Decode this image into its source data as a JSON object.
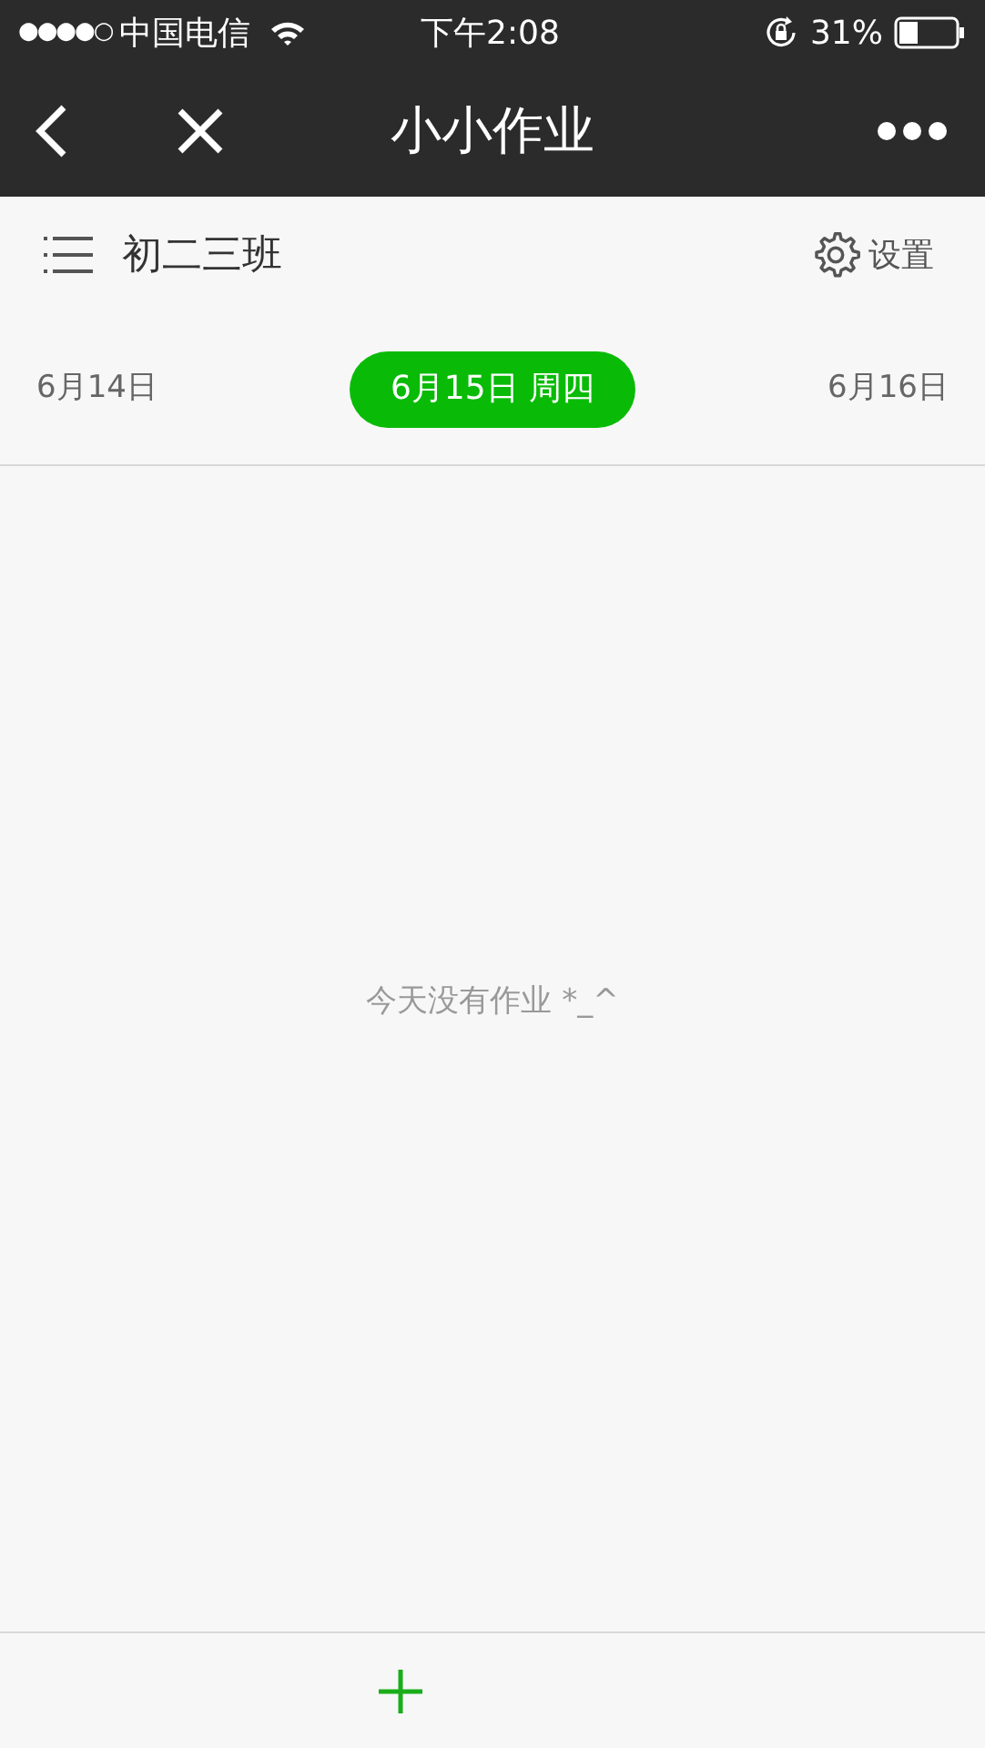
{
  "status_bar": {
    "signal_dots": "●●●●○",
    "carrier": "中国电信",
    "time": "下午2:08",
    "battery": "31%"
  },
  "nav_bar": {
    "title": "小小作业"
  },
  "header": {
    "class_name": "初二三班",
    "settings": "设置"
  },
  "dates": [
    {
      "label": "6月14日",
      "selected": false
    },
    {
      "label": "6月15日 周四",
      "selected": true
    },
    {
      "label": "6月16日",
      "selected": false
    }
  ],
  "empty_message": "今天没有作业 *_^"
}
